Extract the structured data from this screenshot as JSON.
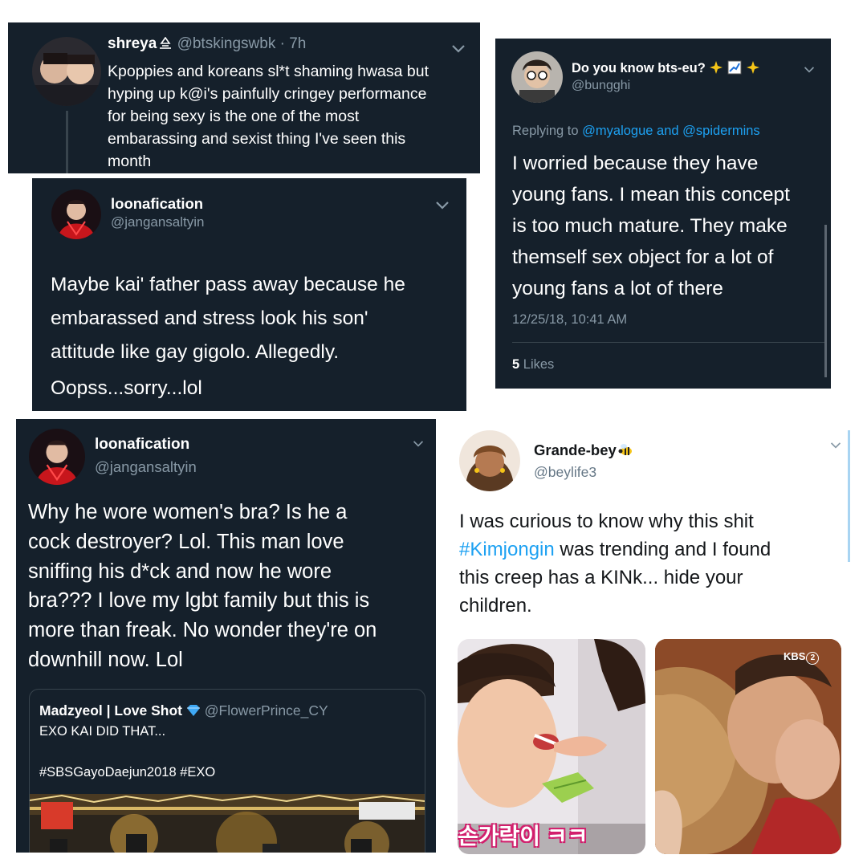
{
  "tweet1": {
    "display_name": "shreya",
    "handle": "@btskingswbk",
    "time": "· 7h",
    "body_lines": [
      "Kpoppies and koreans sl*t shaming hwasa but",
      "hyping up k@i's painfully cringey performance",
      "for being sexy is the one of the most",
      "embarassing and sexist thing I've seen this",
      "month"
    ]
  },
  "tweet2": {
    "display_name": "loonafication",
    "handle": "@jangansaltyin",
    "body_lines": [
      "Maybe kai' father pass away because he",
      "embarassed and stress look his son'",
      "attitude like gay gigolo. Allegedly."
    ],
    "body_last": "Oopss...sorry...lol"
  },
  "tweet3": {
    "display_name": "Do you know bts-eu?",
    "handle": "@bungghi",
    "replying_prefix": "Replying to",
    "replying_handles": "@myalogue and @spidermins",
    "body_lines": [
      "I worried because they have",
      "young fans. I mean this concept",
      "is too much mature. They make",
      "themself sex object for a lot of",
      "young fans a lot of there"
    ],
    "timestamp": "12/25/18, 10:41 AM",
    "likes_count": "5",
    "likes_label": "Likes"
  },
  "tweet4": {
    "display_name": "loonafication",
    "handle": "@jangansaltyin",
    "body_lines": [
      "Why he wore women's bra? Is he a",
      "cock destroyer? Lol. This man love",
      "sniffing his d*ck and now he wore",
      "bra??? I love my lgbt family but this is",
      "more than freak. No wonder they're on",
      "downhill now. Lol"
    ],
    "quote": {
      "display_name": "Madzyeol | Love Shot",
      "handle": "@FlowerPrince_CY",
      "line1": "EXO KAI DID THAT...",
      "hashtags": "#SBSGayoDaejun2018 #EXO"
    }
  },
  "tweet5": {
    "display_name": "Grande-bey",
    "handle": "@beylife3",
    "line1": "I was curious to know why this shit",
    "hashtag": "#Kimjongin",
    "line2_rest": " was trending and I found",
    "line3": "this creep has a KINk... hide your",
    "line4": "children.",
    "image_caption": "손가락이 ㅋㅋ",
    "image_watermark": "KBS",
    "image_watermark_num": "2"
  },
  "icons": {
    "chevron": "chevron-down-icon",
    "emoji": [
      "sparkle-emoji-icon",
      "chart-emoji-icon",
      "bee-emoji-icon"
    ]
  },
  "colors": {
    "dark_bg": "#15202b",
    "link_blue": "#1da1f2",
    "gray": "#8899a6"
  }
}
